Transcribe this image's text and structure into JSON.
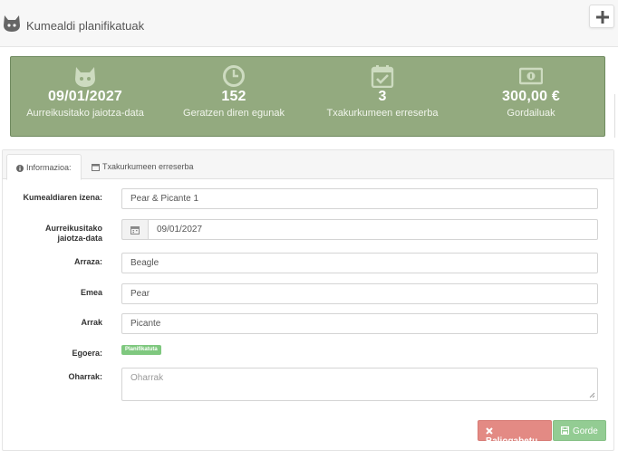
{
  "header": {
    "title": "Kumealdi planifikatuak",
    "logo_icon": "github-cat-icon",
    "add_icon": "plus-icon"
  },
  "stats": [
    {
      "icon": "cat-icon",
      "value": "09/01/2027",
      "label": "Aurreikusitako jaiotza-data"
    },
    {
      "icon": "clock-icon",
      "value": "152",
      "label": "Geratzen diren egunak"
    },
    {
      "icon": "calendar-check-icon",
      "value": "3",
      "label": "Txakurkumeen erreserba"
    },
    {
      "icon": "money-icon",
      "value": "300,00 €",
      "label": "Gordailuak"
    }
  ],
  "tabs": [
    {
      "icon": "info-icon",
      "label": "Informazioa:"
    },
    {
      "icon": "calendar-icon",
      "label": "Txakurkumeen erreserba"
    }
  ],
  "form": {
    "name": {
      "label": "Kumealdiaren izena:",
      "value": "Pear & Picante 1"
    },
    "birth": {
      "label_line1": "Aurreikusitako",
      "label_line2": "jaiotza-data",
      "value": "09/01/2027"
    },
    "breed": {
      "label": "Arraza:",
      "value": "Beagle"
    },
    "female": {
      "label": "Emea",
      "value": "Pear"
    },
    "male": {
      "label": "Arrak",
      "value": "Picante"
    },
    "status": {
      "label": "Egoera:",
      "value": "Planifikatuta"
    },
    "notes": {
      "label": "Oharrak:",
      "value": "",
      "placeholder": "Oharrak"
    }
  },
  "buttons": {
    "cancel": "Baliogabetu",
    "save": "Gorde"
  },
  "colors": {
    "stats_bg": "#93aa7f",
    "cancel": "#e38a84",
    "save": "#93cc93",
    "badge": "#7fc87f"
  }
}
